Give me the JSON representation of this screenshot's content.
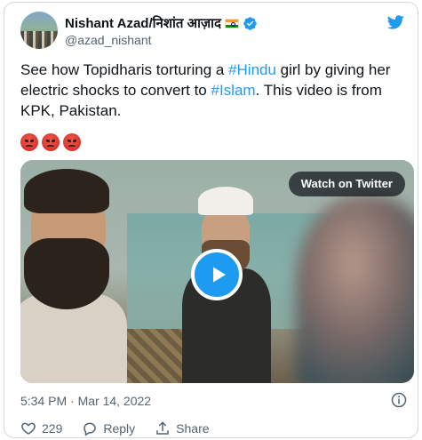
{
  "author": {
    "display_name": "Nishant Azad/निशांत आज़ाद",
    "handle": "@azad_nishant",
    "verified": true,
    "flag_emoji": "indian-flag"
  },
  "tweet": {
    "text_part1": "See how Topidharis torturing a ",
    "hashtag1": "#Hindu",
    "text_part2": " girl by giving her electric shocks to convert to ",
    "hashtag2": "#Islam",
    "text_part3": ". This video is from KPK, Pakistan.",
    "emojis": [
      "angry-face",
      "angry-face",
      "angry-face"
    ]
  },
  "media": {
    "watch_label": "Watch on Twitter",
    "type": "video"
  },
  "meta": {
    "timestamp": "5:34 PM · Mar 14, 2022"
  },
  "actions": {
    "like_count": "229",
    "reply_label": "Reply",
    "share_label": "Share"
  },
  "colors": {
    "accent": "#1d9bf0",
    "secondary_text": "#536471",
    "primary_text": "#0f1419",
    "border": "#cfd9de"
  }
}
